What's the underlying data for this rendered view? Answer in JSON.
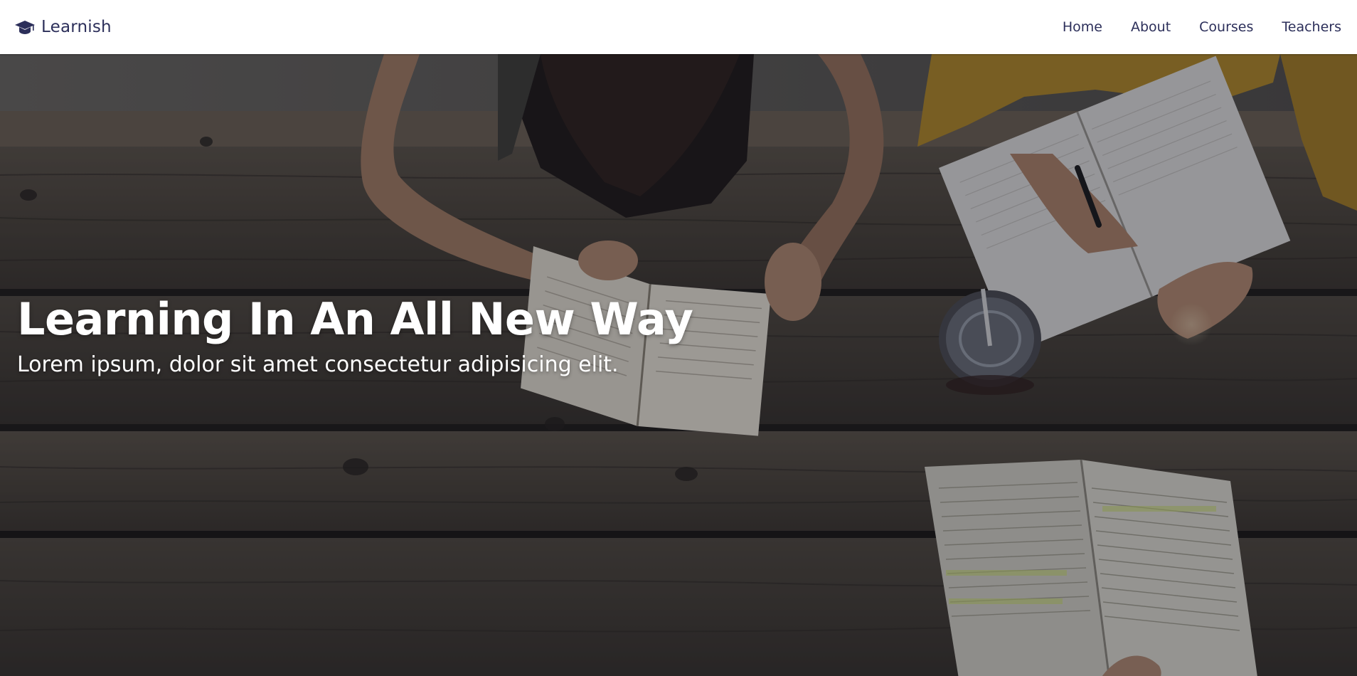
{
  "brand": {
    "name": "Learnish",
    "icon": "graduation-cap-icon"
  },
  "nav": {
    "items": [
      {
        "label": "Home"
      },
      {
        "label": "About"
      },
      {
        "label": "Courses"
      },
      {
        "label": "Teachers"
      }
    ]
  },
  "hero": {
    "title": "Learning In An All New Way",
    "subtitle": "Lorem ipsum, dolor sit amet consectetur adipisicing elit."
  },
  "colors": {
    "nav_background": "#ffffff",
    "nav_text": "#2c2f5a",
    "hero_text": "#ffffff",
    "hero_overlay": "rgba(22,24,38,0.38)"
  }
}
